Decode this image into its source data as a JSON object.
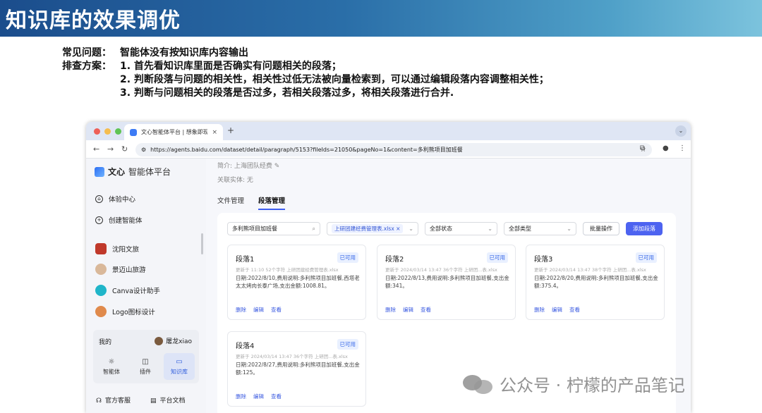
{
  "slide": {
    "title": "知识库的效果调优",
    "problem_label": "常见问题：",
    "problem_text": "智能体没有按知识库内容输出",
    "solution_label": "排查方案：",
    "steps": [
      "1. 首先看知识库里面是否确实有问题相关的段落；",
      "2. 判断段落与问题的相关性，相关性过低无法被向量检索到，可以通过编辑段落内容调整相关性；",
      "3. 判断与问题相关的段落是否过多，若相关段落过多，将相关段落进行合并."
    ]
  },
  "browser": {
    "tab_title": "文心智能体平台 | 想象即现实",
    "tab_close": "×",
    "new_tab": "+",
    "url": "https://agents.baidu.com/dataset/detail/paragraph/5153?fileIds=21050&pageNo=1&content=多利熊项目加班餐"
  },
  "sidebar": {
    "brand_bold": "文心",
    "brand_rest": "智能体平台",
    "nav": [
      "体验中心",
      "创建智能体"
    ],
    "agents": [
      "沈阳文旅",
      "景迈山旅游",
      "Canva设计助手",
      "Logo图标设计"
    ],
    "my_label": "我的",
    "user_name": "屠龙xiao",
    "my_buttons": [
      "智能体",
      "插件",
      "知识库"
    ],
    "footer": [
      "官方客服",
      "平台文档"
    ]
  },
  "main": {
    "intro": "简介: 上海团队经费",
    "relation": "关联实体: 无",
    "tabs": [
      "文件管理",
      "段落管理"
    ],
    "filters": {
      "search_value": "多利熊项目加班餐",
      "file_chip": "上研团建经费管理表.xlsx",
      "chip_close": "×",
      "status": "全部状态",
      "type": "全部类型",
      "batch": "批量操作",
      "add": "添加段落"
    },
    "cards": [
      {
        "title": "段落1",
        "status": "已可用",
        "meta": "更新于 11:10  52个字符  上研团建经费管理表.xlsx",
        "body": "日期:2022/8/10,费用说明:多利熊项目加班餐,西塔老太太烤肉长泰广场,支出金额:1008.81。",
        "actions": [
          "删除",
          "编辑",
          "查看"
        ]
      },
      {
        "title": "段落2",
        "status": "已可用",
        "meta": "更新于 2024/03/14 13:47  36个字符  上研团...表.xlsx",
        "body": "日期:2022/8/13,费用说明:多利熊项目加班餐,支出金额:341。",
        "actions": [
          "删除",
          "编辑",
          "查看"
        ]
      },
      {
        "title": "段落3",
        "status": "已可用",
        "meta": "更新于 2024/03/14 13:47  38个字符  上研团...表.xlsx",
        "body": "日期:2022/8/20,费用说明:多利熊项目加班餐,支出金额:375.4。",
        "actions": [
          "删除",
          "编辑",
          "查看"
        ]
      },
      {
        "title": "段落4",
        "status": "已可用",
        "meta": "更新于 2024/03/14 13:47  36个字符  上研团...表.xlsx",
        "body": "日期:2022/8/27,费用说明:多利熊项目加班餐,支出金额:125。",
        "actions": [
          "删除",
          "编辑",
          "查看"
        ]
      }
    ]
  },
  "watermark": "公众号 · 柠檬的产品笔记",
  "colors": {
    "accent": "#4d63f0",
    "header": "#2a6ea8"
  }
}
